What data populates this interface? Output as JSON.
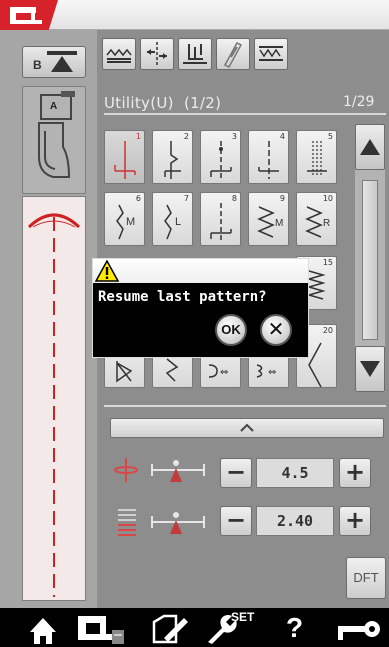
{
  "pattern_panel": {
    "title": "Utility(U)  (1/2)",
    "page_count": "1/29",
    "stitch_numbers": [
      "1",
      "2",
      "3",
      "4",
      "5",
      "6",
      "7",
      "8",
      "9",
      "10",
      "15",
      "20"
    ]
  },
  "settings": {
    "width_value": "4.5",
    "length_value": "2.40",
    "minus_label": "−",
    "plus_label": "+"
  },
  "dft_label": "DFT",
  "needle_position_label": "B",
  "foot_label": "A",
  "dialog": {
    "message": "Resume last pattern?",
    "ok_label": "OK",
    "cancel_label": "✕"
  },
  "bottom_bar": {
    "set_label": "SET",
    "help_label": "?"
  },
  "colors": {
    "accent_red": "#d6222b",
    "panel_gray": "#8d8d8d"
  }
}
